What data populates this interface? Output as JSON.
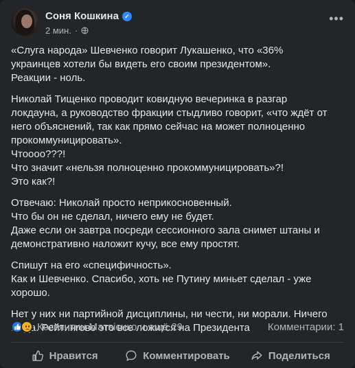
{
  "post": {
    "author": "Соня Кошкина",
    "time": "2 мин.",
    "more_label": "•••",
    "paragraphs": [
      "«Слуга народа» Шевченко говорит Лукашенко, что «36%\nукраинцев хотели бы видеть его своим президентом».\nРеакции - ноль.",
      "Николай Тищенко проводит ковидную вечеринка в разгар\nлокдауна, а руководство фракции стыдливо говорит, «что ждёт от\nнего объяснений, так как прямо сейчас на может полноценно\nпрокоммуницировать».\nЧтоооо???!\nЧто значит «нельзя полноценно прокоммуницировать»?!\nЭто как?!",
      "Отвечаю: Николай просто неприкосновенный.\nЧто бы он не сделал, ничего ему не будет.\nДаже если он завтра посреди сессионного зала снимет штаны и\nдемонстративно наложит кучу, все ему простят.",
      "Спишут на его «специфичность».\nКак и Шевченко. Спасибо, хоть не Путину миньет сделал - уже\nхорошо.",
      "Нет у них ни партийной дисциплины, ни чести, ни морали. Ничего\nИ, да. Рейтингово это все ложится на Президента"
    ],
    "reactions_text": "Костянтин Матвієнко и ещё 29",
    "comments_text": "Комментарии: 1"
  },
  "actions": {
    "like": "Нравится",
    "comment": "Комментировать",
    "share": "Поделиться"
  },
  "colors": {
    "background": "#242526",
    "text": "#e4e6eb",
    "secondary": "#b0b3b8",
    "verified": "#2d88ff",
    "like": "#2078f4",
    "sad": "#f7b125"
  }
}
